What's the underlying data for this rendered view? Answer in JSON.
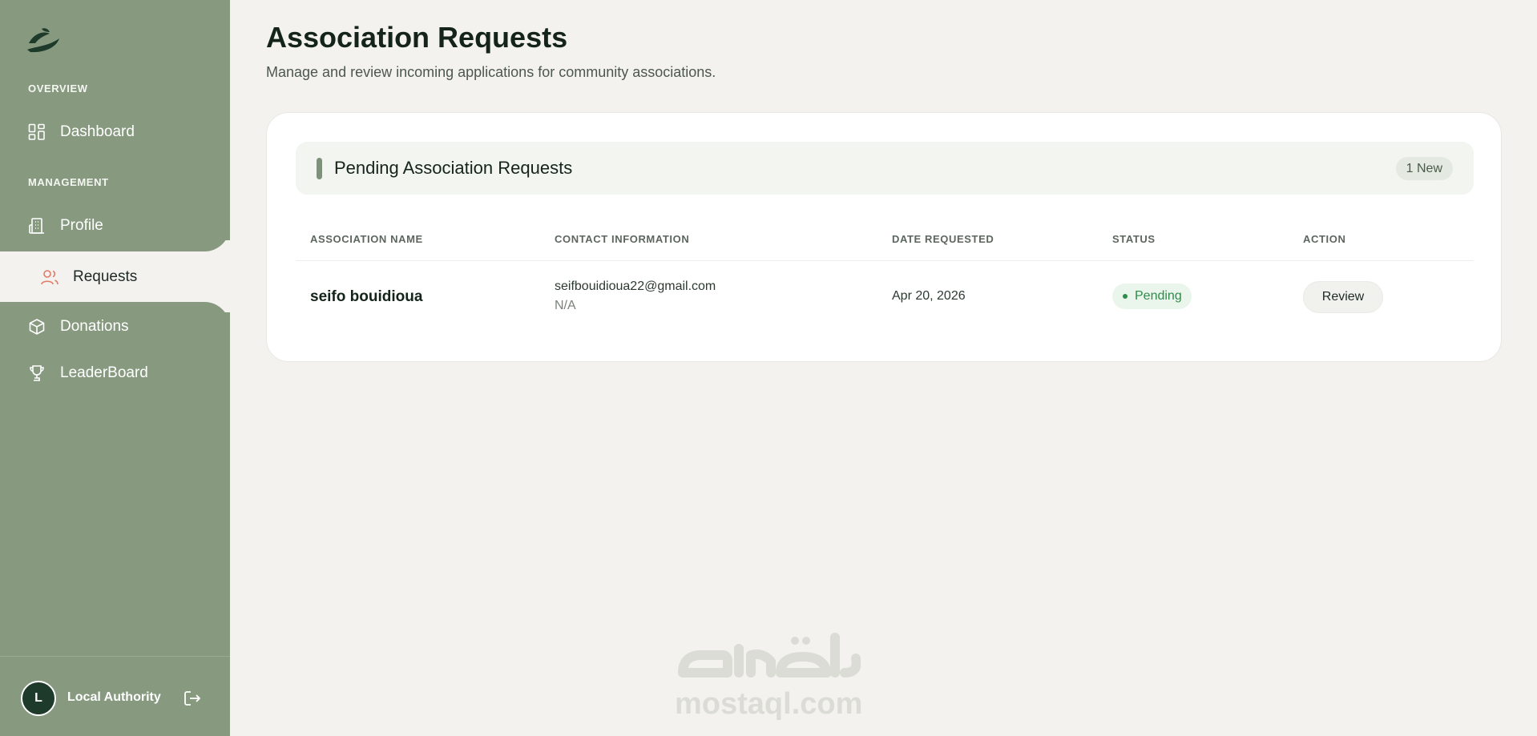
{
  "sidebar": {
    "sections": {
      "overview": "OVERVIEW",
      "management": "MANAGEMENT"
    },
    "items": [
      {
        "label": "Dashboard",
        "icon": "dashboard-grid-icon"
      },
      {
        "label": "Profile",
        "icon": "building-icon"
      },
      {
        "label": "Requests",
        "icon": "users-icon",
        "active": true
      },
      {
        "label": "Donations",
        "icon": "box-icon"
      },
      {
        "label": "LeaderBoard",
        "icon": "trophy-icon"
      }
    ],
    "footer": {
      "avatar_initial": "L",
      "user_name": "Local Authority",
      "logout_icon": "logout-icon"
    }
  },
  "header": {
    "title": "Association Requests",
    "subtitle": "Manage and review incoming applications for community associations."
  },
  "card": {
    "title": "Pending Association Requests",
    "badge": "1 New",
    "columns": [
      "ASSOCIATION NAME",
      "CONTACT INFORMATION",
      "DATE REQUESTED",
      "STATUS",
      "ACTION"
    ],
    "rows": [
      {
        "name": "seifo bouidioua",
        "email": "seifbouidioua22@gmail.com",
        "phone": "N/A",
        "date": "Apr 20, 2026",
        "status": "Pending",
        "action": "Review"
      }
    ]
  },
  "watermark": {
    "text": "mostaql.com"
  },
  "colors": {
    "sidebar": "#879a80",
    "background": "#f3f2ee",
    "status_pending": "#2e8b4a",
    "active_icon": "#e07a6a"
  }
}
